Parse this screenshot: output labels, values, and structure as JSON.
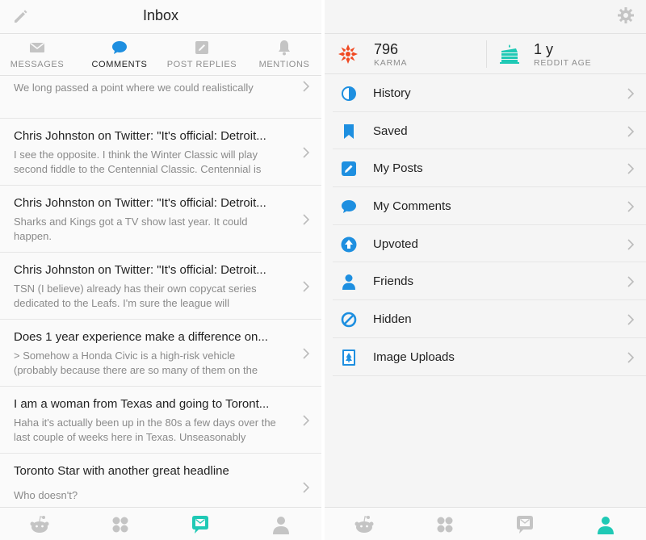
{
  "inbox": {
    "title": "Inbox",
    "tabs": [
      {
        "label": "MESSAGES",
        "icon": "envelope-icon",
        "active": false
      },
      {
        "label": "COMMENTS",
        "icon": "speech-bubble-icon",
        "active": true
      },
      {
        "label": "POST REPLIES",
        "icon": "post-reply-icon",
        "active": false
      },
      {
        "label": "MENTIONS",
        "icon": "bell-icon",
        "active": false
      }
    ],
    "items": [
      {
        "title": "",
        "body": "We long passed a point where we could realistically"
      },
      {
        "title": "Chris Johnston on Twitter: \"It's official: Detroit...",
        "body": "I see the opposite. I think the Winter Classic will play second fiddle to the Centennial Classic. Centennial is"
      },
      {
        "title": "Chris Johnston on Twitter: \"It's official: Detroit...",
        "body": "Sharks and Kings got a TV show last year.  It could happen."
      },
      {
        "title": "Chris Johnston on Twitter: \"It's official: Detroit...",
        "body": "TSN (I believe) already has their own copycat series dedicated to the Leafs.  I'm sure the league will"
      },
      {
        "title": "Does 1 year experience make a difference on...",
        "body": ">  Somehow a Honda Civic is a high-risk vehicle (probably because there are so many of them on the"
      },
      {
        "title": "I am a woman from Texas and going to Toront...",
        "body": "Haha it's actually been up in the 80s a few days over the last couple of weeks here in Texas. Unseasonably"
      },
      {
        "title": "Toronto Star with another great headline",
        "body": "Who doesn't?"
      }
    ]
  },
  "profile": {
    "karma": {
      "value": "796",
      "label": "KARMA"
    },
    "age": {
      "value": "1 y",
      "label": "REDDIT AGE"
    },
    "menu": [
      {
        "label": "History",
        "icon": "history-icon"
      },
      {
        "label": "Saved",
        "icon": "bookmark-icon"
      },
      {
        "label": "My Posts",
        "icon": "pencil-square-icon"
      },
      {
        "label": "My Comments",
        "icon": "speech-bubble-icon"
      },
      {
        "label": "Upvoted",
        "icon": "upvote-icon"
      },
      {
        "label": "Friends",
        "icon": "person-icon"
      },
      {
        "label": "Hidden",
        "icon": "hidden-icon"
      },
      {
        "label": "Image Uploads",
        "icon": "image-upload-icon"
      }
    ]
  },
  "colors": {
    "accent_blue": "#1e8fe0",
    "active_teal": "#1fc9b5",
    "karma_orange": "#f04a23",
    "icon_gray": "#c4c4c4"
  }
}
